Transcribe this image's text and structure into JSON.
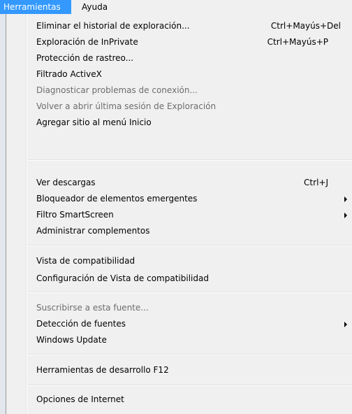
{
  "menubar": {
    "items": [
      {
        "label": "Herramientas"
      },
      {
        "label": "Ayuda"
      }
    ]
  },
  "menu": {
    "items": [
      {
        "label": "Eliminar el historial de exploración...",
        "shortcut": "Ctrl+Mayús+Del",
        "disabled": false
      },
      {
        "label": "Exploración de InPrivate",
        "shortcut": "Ctrl+Mayús+P",
        "disabled": false
      },
      {
        "label": "Protección de rastreo...",
        "disabled": false
      },
      {
        "label": "Filtrado ActiveX",
        "disabled": false
      },
      {
        "label": "Diagnosticar problemas de conexión...",
        "disabled": true
      },
      {
        "label": "Volver a abrir última sesión de Exploración",
        "disabled": true
      },
      {
        "label": "Agregar sitio al menú Inicio",
        "disabled": false
      },
      {
        "label": "Ver descargas",
        "shortcut": "Ctrl+J",
        "disabled": false
      },
      {
        "label": "Bloqueador de elementos emergentes",
        "submenu": true,
        "disabled": false
      },
      {
        "label": "Filtro SmartScreen",
        "submenu": true,
        "disabled": false
      },
      {
        "label": "Administrar complementos",
        "disabled": false
      },
      {
        "label": "Vista de compatibilidad",
        "disabled": false
      },
      {
        "label": "Configuración de Vista de compatibilidad",
        "disabled": false
      },
      {
        "label": "Suscribirse a esta fuente...",
        "disabled": true
      },
      {
        "label": "Detección de fuentes",
        "submenu": true,
        "disabled": false
      },
      {
        "label": "Windows Update",
        "disabled": false
      },
      {
        "label": "Herramientas de desarrollo F12",
        "disabled": false
      },
      {
        "label": "Opciones de Internet",
        "disabled": false
      }
    ]
  }
}
